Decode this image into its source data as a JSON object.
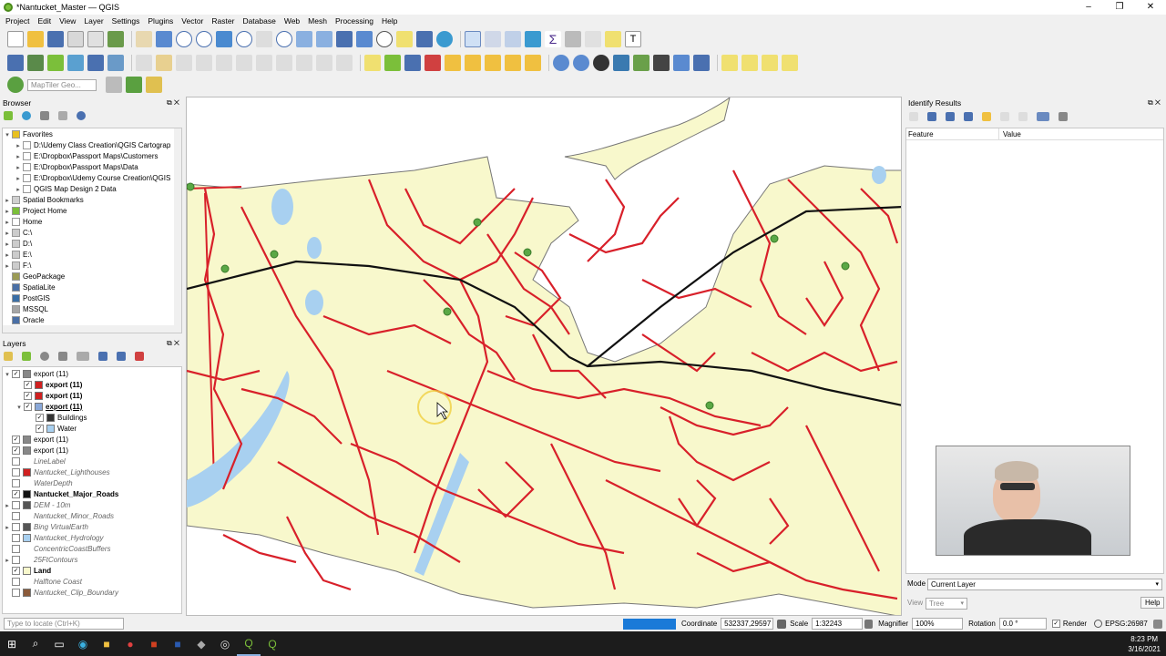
{
  "window": {
    "title": "*Nantucket_Master — QGIS",
    "minimize": "–",
    "maximize": "❐",
    "close": "✕"
  },
  "menu": [
    "Project",
    "Edit",
    "View",
    "Layer",
    "Settings",
    "Plugins",
    "Vector",
    "Raster",
    "Database",
    "Web",
    "Mesh",
    "Processing",
    "Help"
  ],
  "search_box": {
    "placeholder": "MapTiler Geo..."
  },
  "browser": {
    "title": "Browser",
    "items": [
      {
        "label": "Favorites",
        "indent": 0,
        "exp": "▾",
        "icon": "star",
        "color": "#e8c020"
      },
      {
        "label": "D:\\Udemy Class Creation\\QGIS Cartograp",
        "indent": 1,
        "exp": "▸",
        "icon": "folder",
        "color": "#fff"
      },
      {
        "label": "E:\\Dropbox\\Passport Maps\\Customers",
        "indent": 1,
        "exp": "▸",
        "icon": "folder",
        "color": "#fff"
      },
      {
        "label": "E:\\Dropbox\\Passport Maps\\Data",
        "indent": 1,
        "exp": "▸",
        "icon": "folder",
        "color": "#fff"
      },
      {
        "label": "E:\\Dropbox\\Udemy Course Creation\\QGIS",
        "indent": 1,
        "exp": "▸",
        "icon": "folder",
        "color": "#fff"
      },
      {
        "label": "QGIS Map Design 2 Data",
        "indent": 1,
        "exp": "▸",
        "icon": "folder",
        "color": "#fff"
      },
      {
        "label": "Spatial Bookmarks",
        "indent": 0,
        "exp": "▸",
        "icon": "bookmark",
        "color": "#d0d0d0"
      },
      {
        "label": "Project Home",
        "indent": 0,
        "exp": "▸",
        "icon": "home",
        "color": "#7bbf3a"
      },
      {
        "label": "Home",
        "indent": 0,
        "exp": "▸",
        "icon": "folder",
        "color": "#fff"
      },
      {
        "label": "C:\\",
        "indent": 0,
        "exp": "▸",
        "icon": "drive",
        "color": "#ccc"
      },
      {
        "label": "D:\\",
        "indent": 0,
        "exp": "▸",
        "icon": "drive",
        "color": "#ccc"
      },
      {
        "label": "E:\\",
        "indent": 0,
        "exp": "▸",
        "icon": "drive",
        "color": "#ccc"
      },
      {
        "label": "F:\\",
        "indent": 0,
        "exp": "▸",
        "icon": "drive",
        "color": "#ccc"
      },
      {
        "label": "GeoPackage",
        "indent": 0,
        "exp": "",
        "icon": "db",
        "color": "#9b9b55"
      },
      {
        "label": "SpatiaLite",
        "indent": 0,
        "exp": "",
        "icon": "feather",
        "color": "#4a6fa5"
      },
      {
        "label": "PostGIS",
        "indent": 0,
        "exp": "",
        "icon": "elephant",
        "color": "#3a6ea5"
      },
      {
        "label": "MSSQL",
        "indent": 0,
        "exp": "",
        "icon": "db",
        "color": "#a5a5a5"
      },
      {
        "label": "Oracle",
        "indent": 0,
        "exp": "",
        "icon": "db",
        "color": "#4a6fa5"
      }
    ]
  },
  "layers": {
    "title": "Layers",
    "items": [
      {
        "label": "export (11)",
        "indent": 0,
        "exp": "▾",
        "checked": true,
        "style": "normal",
        "sym": "#888"
      },
      {
        "label": "export (11)",
        "indent": 1,
        "exp": "",
        "checked": true,
        "style": "bold",
        "sym": "#d02020"
      },
      {
        "label": "export (11)",
        "indent": 1,
        "exp": "",
        "checked": true,
        "style": "bold",
        "sym": "#d02020"
      },
      {
        "label": "export (11)",
        "indent": 1,
        "exp": "▾",
        "checked": true,
        "style": "bold-underline",
        "sym": "#8aa8d8"
      },
      {
        "label": "Buildings",
        "indent": 2,
        "exp": "",
        "checked": true,
        "style": "normal",
        "sym": "#333"
      },
      {
        "label": "Water",
        "indent": 2,
        "exp": "",
        "checked": true,
        "style": "normal",
        "sym": "#a8d0f0"
      },
      {
        "label": "export (11)",
        "indent": 0,
        "exp": "",
        "checked": true,
        "style": "normal",
        "sym": "#888"
      },
      {
        "label": "export (11)",
        "indent": 0,
        "exp": "",
        "checked": true,
        "style": "normal",
        "sym": "#888"
      },
      {
        "label": "LineLabel",
        "indent": 0,
        "exp": "",
        "checked": false,
        "style": "italic",
        "sym": ""
      },
      {
        "label": "Nantucket_Lighthouses",
        "indent": 0,
        "exp": "",
        "checked": false,
        "style": "italic",
        "sym": "#d02020"
      },
      {
        "label": "WaterDepth",
        "indent": 0,
        "exp": "",
        "checked": false,
        "style": "italic",
        "sym": ""
      },
      {
        "label": "Nantucket_Major_Roads",
        "indent": 0,
        "exp": "",
        "checked": true,
        "style": "bold",
        "sym": "#111"
      },
      {
        "label": "DEM - 10m",
        "indent": 0,
        "exp": "▸",
        "checked": false,
        "style": "italic",
        "sym": "#555"
      },
      {
        "label": "Nantucket_Minor_Roads",
        "indent": 0,
        "exp": "",
        "checked": false,
        "style": "italic",
        "sym": ""
      },
      {
        "label": "Bing VirtualEarth",
        "indent": 0,
        "exp": "▸",
        "checked": false,
        "style": "italic",
        "sym": "#555"
      },
      {
        "label": "Nantucket_Hydrology",
        "indent": 0,
        "exp": "",
        "checked": false,
        "style": "italic",
        "sym": "#a8d0f0"
      },
      {
        "label": "ConcentricCoastBuffers",
        "indent": 0,
        "exp": "",
        "checked": false,
        "style": "italic",
        "sym": ""
      },
      {
        "label": "25FtContours",
        "indent": 0,
        "exp": "▸",
        "checked": false,
        "style": "italic",
        "sym": ""
      },
      {
        "label": "Land",
        "indent": 0,
        "exp": "",
        "checked": true,
        "style": "bold",
        "sym": "#f8f8cc"
      },
      {
        "label": "Halftone Coast",
        "indent": 0,
        "exp": "",
        "checked": false,
        "style": "italic",
        "sym": ""
      },
      {
        "label": "Nantucket_Clip_Boundary",
        "indent": 0,
        "exp": "",
        "checked": false,
        "style": "italic",
        "sym": "#8b5a3a"
      }
    ]
  },
  "identify": {
    "title": "Identify Results",
    "col_feature": "Feature",
    "col_value": "Value",
    "mode_label": "Mode",
    "mode_value": "Current Layer",
    "view_label": "View",
    "view_value": "Tree",
    "help": "Help"
  },
  "status": {
    "locate_placeholder": "Type to locate (Ctrl+K)",
    "coordinate_label": "Coordinate",
    "coordinate_value": "532337,29597",
    "scale_label": "Scale",
    "scale_value": "1:32243",
    "magnifier_label": "Magnifier",
    "magnifier_value": "100%",
    "rotation_label": "Rotation",
    "rotation_value": "0.0 °",
    "render_label": "Render",
    "crs": "EPSG:26987"
  },
  "taskbar": {
    "time": "8:23 PM",
    "date": "3/16/2021"
  },
  "colors": {
    "land": "#f8f8cc",
    "water": "#a8d0f0",
    "roads": "#d8202a",
    "major_roads": "#111111",
    "points": "#5aa845"
  }
}
